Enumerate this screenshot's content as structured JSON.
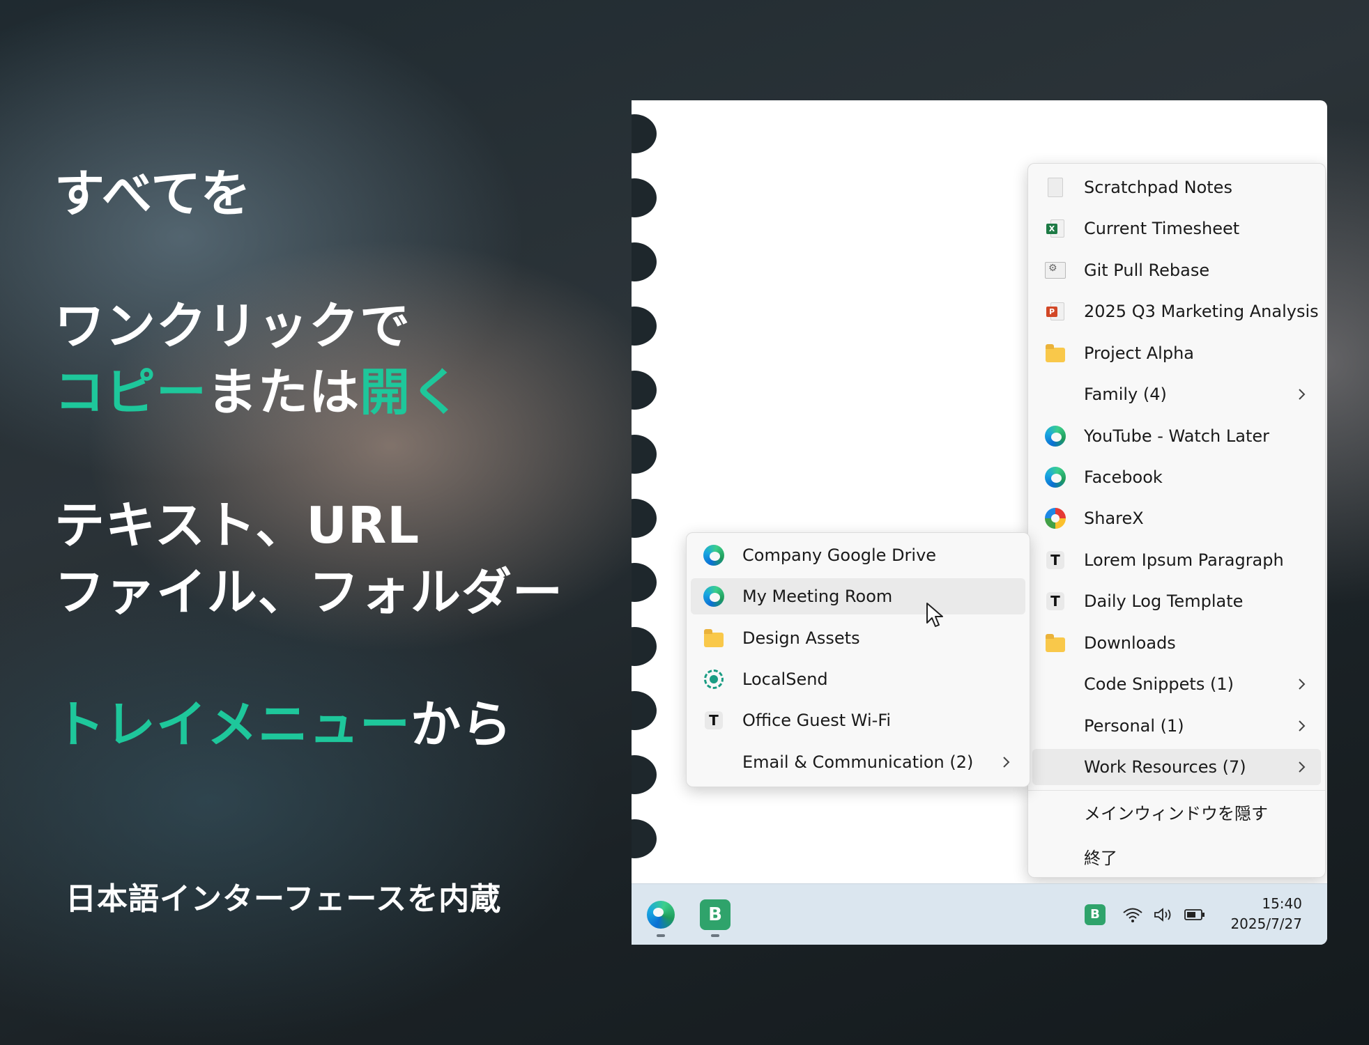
{
  "hero": {
    "line1": "すべてを",
    "line2": "ワンクリックで",
    "line3_accent1": "コピー",
    "line3_mid": "または",
    "line3_accent2": "開く",
    "line4": "テキスト、URL",
    "line5": "ファイル、フォルダー",
    "line6_accent": "トレイメニュー",
    "line6_rest": "から",
    "footer": "日本語インターフェースを内蔵",
    "accent_color": "#1ec79b"
  },
  "tray_menu": {
    "items": [
      {
        "label": "Scratchpad Notes",
        "icon": "document-icon"
      },
      {
        "label": "Current Timesheet",
        "icon": "excel-icon"
      },
      {
        "label": "Git Pull Rebase",
        "icon": "batch-file-icon"
      },
      {
        "label": "2025 Q3 Marketing Analysis",
        "icon": "powerpoint-icon"
      },
      {
        "label": "Project Alpha",
        "icon": "folder-icon"
      },
      {
        "label": "Family  (4)",
        "icon": "",
        "submenu": true
      },
      {
        "label": "YouTube - Watch Later",
        "icon": "edge-icon"
      },
      {
        "label": "Facebook",
        "icon": "edge-icon"
      },
      {
        "label": "ShareX",
        "icon": "sharex-icon"
      },
      {
        "label": "Lorem Ipsum Paragraph",
        "icon": "text-icon"
      },
      {
        "label": "Daily Log Template",
        "icon": "text-icon"
      },
      {
        "label": "Downloads",
        "icon": "folder-icon"
      },
      {
        "label": "Code Snippets  (1)",
        "icon": "",
        "submenu": true
      },
      {
        "label": "Personal  (1)",
        "icon": "",
        "submenu": true
      },
      {
        "label": "Work Resources  (7)",
        "icon": "",
        "submenu": true,
        "highlighted": true
      }
    ],
    "hide_main_window": "メインウィンドウを隠す",
    "exit": "終了"
  },
  "submenu": {
    "items": [
      {
        "label": "Company Google Drive",
        "icon": "edge-icon"
      },
      {
        "label": "My Meeting Room",
        "icon": "edge-icon",
        "highlighted": true
      },
      {
        "label": "Design Assets",
        "icon": "folder-icon"
      },
      {
        "label": "LocalSend",
        "icon": "localsend-icon"
      },
      {
        "label": "Office Guest Wi-Fi",
        "icon": "text-icon"
      },
      {
        "label": "Email & Communication  (2)",
        "icon": "",
        "submenu": true
      }
    ]
  },
  "taskbar": {
    "pinned": [
      "edge-icon",
      "app-b-icon"
    ],
    "tray_icons": [
      "app-b-tray-icon",
      "wifi-icon",
      "volume-icon",
      "battery-icon"
    ],
    "time": "15:40",
    "date": "2025/7/27",
    "app_badge_letter": "B",
    "app_color": "#2fa36b"
  }
}
